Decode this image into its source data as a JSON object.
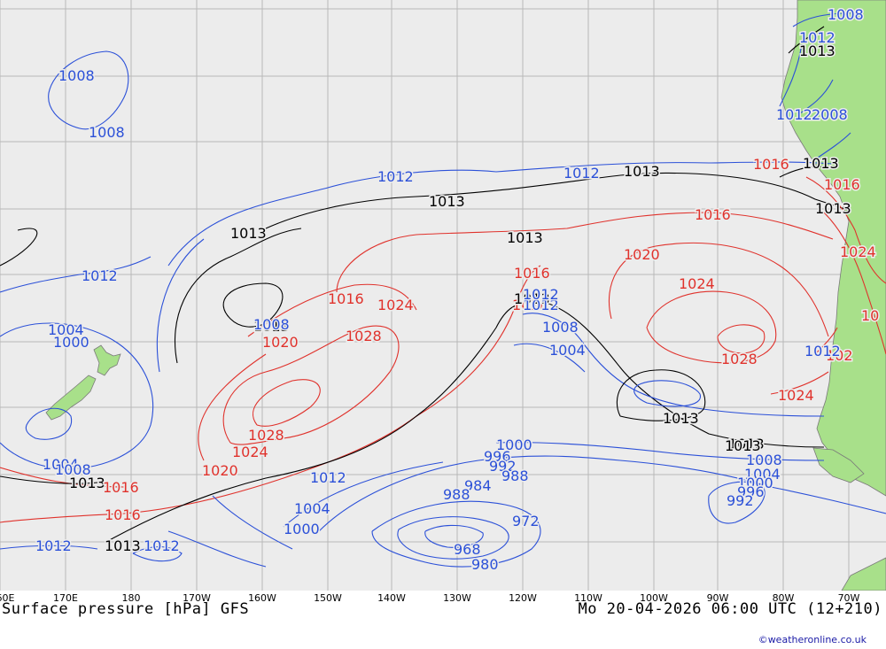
{
  "map": {
    "colors": {
      "ocean": "#ececec",
      "land": "#a8e08a",
      "grid": "#b8b8b8",
      "low_pressure_isobar": "#2b50d8",
      "high_pressure_isobar": "#e0322c",
      "mean_isobar": "#000000"
    },
    "isobar_labels": [
      {
        "text": "1008",
        "tone": "blue"
      },
      {
        "text": "1008",
        "tone": "blue"
      },
      {
        "text": "1012",
        "tone": "blue"
      },
      {
        "text": "1004",
        "tone": "blue"
      },
      {
        "text": "1000",
        "tone": "blue"
      },
      {
        "text": "1004",
        "tone": "blue"
      },
      {
        "text": "1008",
        "tone": "blue"
      },
      {
        "text": "1013",
        "tone": "black"
      },
      {
        "text": "1016",
        "tone": "red"
      },
      {
        "text": "1016",
        "tone": "red"
      },
      {
        "text": "1012",
        "tone": "blue"
      },
      {
        "text": "1013",
        "tone": "black"
      },
      {
        "text": "1012",
        "tone": "blue"
      },
      {
        "text": "1013",
        "tone": "black"
      },
      {
        "text": "1012",
        "tone": "blue"
      },
      {
        "text": "1013",
        "tone": "black"
      },
      {
        "text": "1012",
        "tone": "blue"
      },
      {
        "text": "1013",
        "tone": "black"
      },
      {
        "text": "1013",
        "tone": "black"
      },
      {
        "text": "1016",
        "tone": "red"
      },
      {
        "text": "1024",
        "tone": "red"
      },
      {
        "text": "1020",
        "tone": "red"
      },
      {
        "text": "1028",
        "tone": "red"
      },
      {
        "text": "1028",
        "tone": "red"
      },
      {
        "text": "1024",
        "tone": "red"
      },
      {
        "text": "1020",
        "tone": "red"
      },
      {
        "text": "1013",
        "tone": "black"
      },
      {
        "text": "1016",
        "tone": "red"
      },
      {
        "text": "1016",
        "tone": "red"
      },
      {
        "text": "1013",
        "tone": "black"
      },
      {
        "text": "1012",
        "tone": "blue"
      },
      {
        "text": "1008",
        "tone": "blue"
      },
      {
        "text": "1004",
        "tone": "blue"
      },
      {
        "text": "1020",
        "tone": "red"
      },
      {
        "text": "1016",
        "tone": "red"
      },
      {
        "text": "1024",
        "tone": "red"
      },
      {
        "text": "1028",
        "tone": "red"
      },
      {
        "text": "1013",
        "tone": "black"
      },
      {
        "text": "1024",
        "tone": "red"
      },
      {
        "text": "1013",
        "tone": "black"
      },
      {
        "text": "1000",
        "tone": "blue"
      },
      {
        "text": "996",
        "tone": "blue"
      },
      {
        "text": "992",
        "tone": "blue"
      },
      {
        "text": "988",
        "tone": "blue"
      },
      {
        "text": "984",
        "tone": "blue"
      },
      {
        "text": "988",
        "tone": "blue"
      },
      {
        "text": "972",
        "tone": "blue"
      },
      {
        "text": "968",
        "tone": "blue"
      },
      {
        "text": "980",
        "tone": "blue"
      },
      {
        "text": "1004",
        "tone": "blue"
      },
      {
        "text": "1000",
        "tone": "blue"
      },
      {
        "text": "1008",
        "tone": "blue"
      },
      {
        "text": "1004",
        "tone": "blue"
      },
      {
        "text": "1000",
        "tone": "blue"
      },
      {
        "text": "996",
        "tone": "blue"
      },
      {
        "text": "992",
        "tone": "blue"
      },
      {
        "text": "1012",
        "tone": "blue"
      },
      {
        "text": "1008",
        "tone": "blue"
      },
      {
        "text": "1012",
        "tone": "blue"
      },
      {
        "text": "1013",
        "tone": "black"
      },
      {
        "text": "1012",
        "tone": "blue"
      },
      {
        "text": "2008",
        "tone": "blue"
      },
      {
        "text": "1013",
        "tone": "black"
      },
      {
        "text": "1016",
        "tone": "red"
      },
      {
        "text": "1013",
        "tone": "black"
      },
      {
        "text": "1016",
        "tone": "red"
      },
      {
        "text": "1024",
        "tone": "red"
      },
      {
        "text": "102",
        "tone": "red"
      },
      {
        "text": "10",
        "tone": "red"
      },
      {
        "text": "1012",
        "tone": "blue"
      },
      {
        "text": "1008",
        "tone": "blue"
      },
      {
        "text": "1012",
        "tone": "blue"
      },
      {
        "text": "1013",
        "tone": "black"
      }
    ],
    "longitude_ticks": [
      "60E",
      "170E",
      "180",
      "170W",
      "160W",
      "150W",
      "140W",
      "130W",
      "120W",
      "110W",
      "100W",
      "90W",
      "80W",
      "70W"
    ]
  },
  "footer": {
    "title": "Surface pressure [hPa] GFS",
    "valid_time": "Mo 20-04-2026 06:00 UTC (12+210)",
    "credit": "©weatheronline.co.uk"
  }
}
